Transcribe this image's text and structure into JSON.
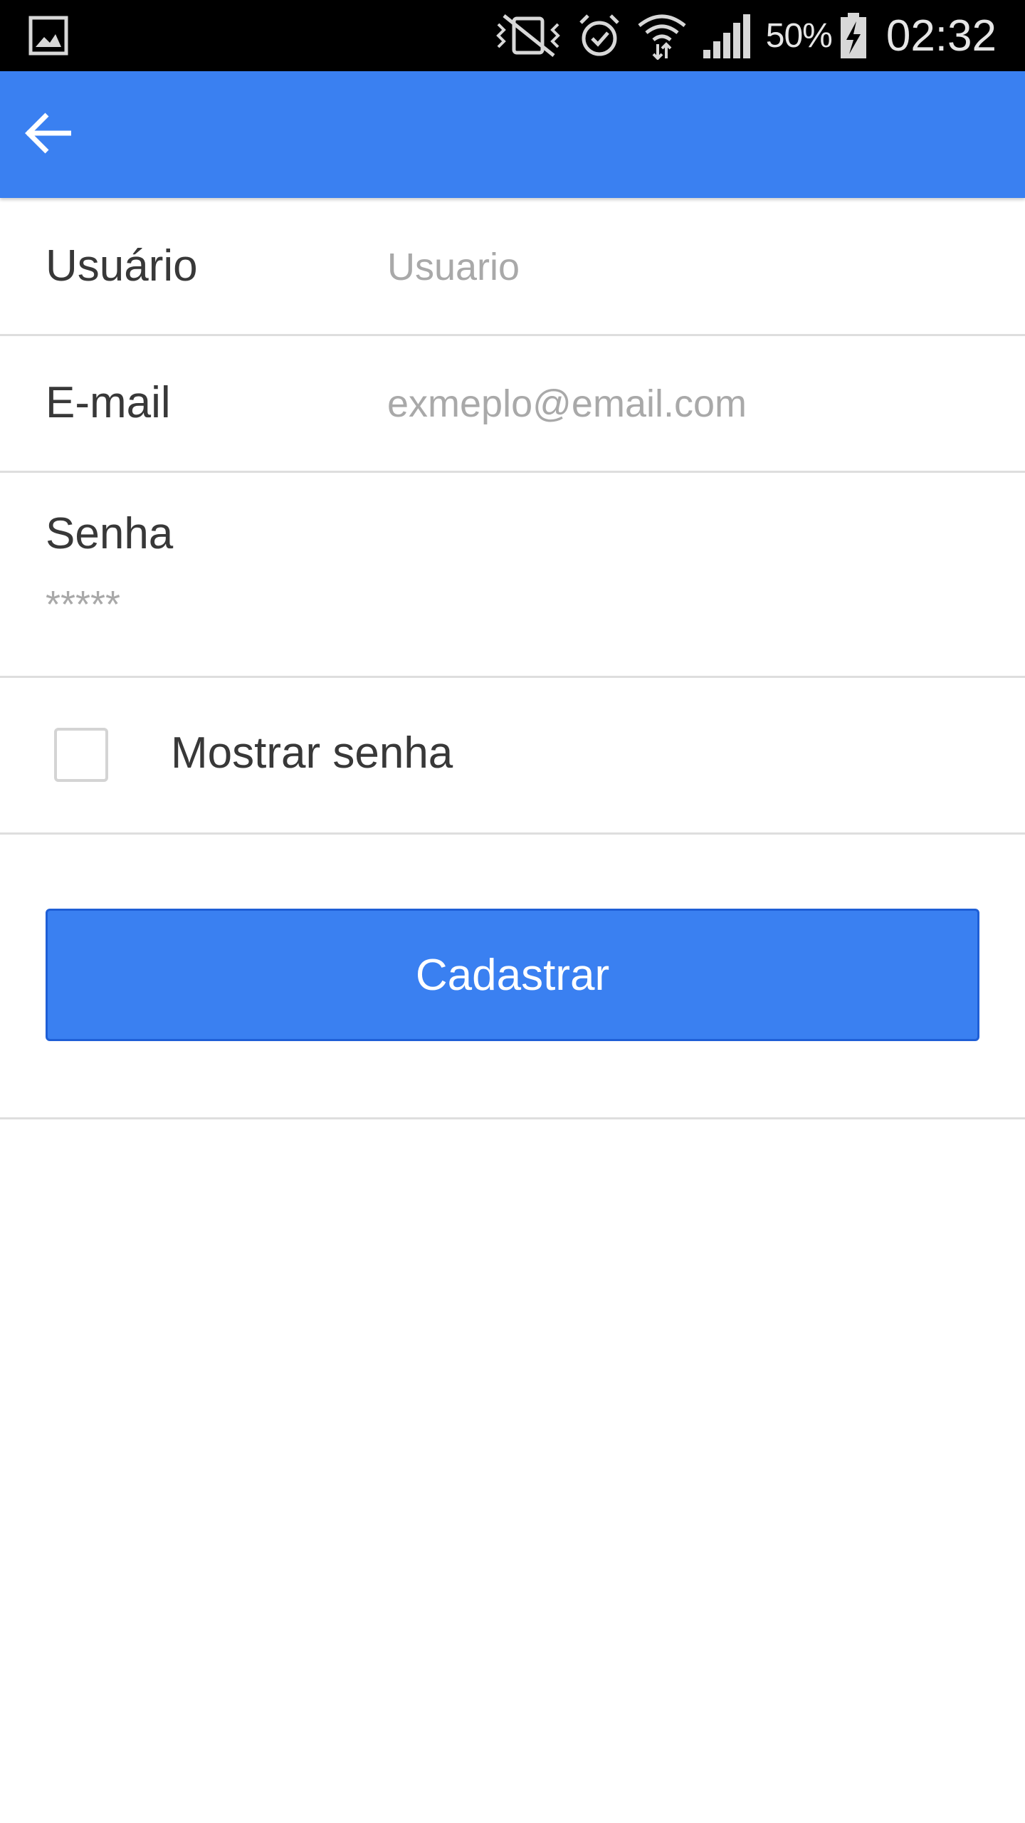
{
  "status_bar": {
    "battery_percent": "50%",
    "time": "02:32",
    "icons": [
      "gallery-icon",
      "vibrate-icon",
      "alarm-icon",
      "wifi-icon",
      "signal-icon",
      "battery-charging-icon"
    ]
  },
  "app_bar": {
    "back_icon": "arrow-back-icon",
    "color": "#3a80f1"
  },
  "form": {
    "usuario": {
      "label": "Usuário",
      "placeholder": "Usuario",
      "value": ""
    },
    "email": {
      "label": "E-mail",
      "placeholder": "exmeplo@email.com",
      "value": ""
    },
    "senha": {
      "label": "Senha",
      "placeholder": "*****",
      "value": ""
    },
    "show_password": {
      "label": "Mostrar senha",
      "checked": false
    },
    "submit": {
      "label": "Cadastrar"
    }
  },
  "colors": {
    "primary": "#3a80f1",
    "status_bar": "#000000",
    "divider": "#dedede",
    "placeholder": "#a9a9a9"
  }
}
